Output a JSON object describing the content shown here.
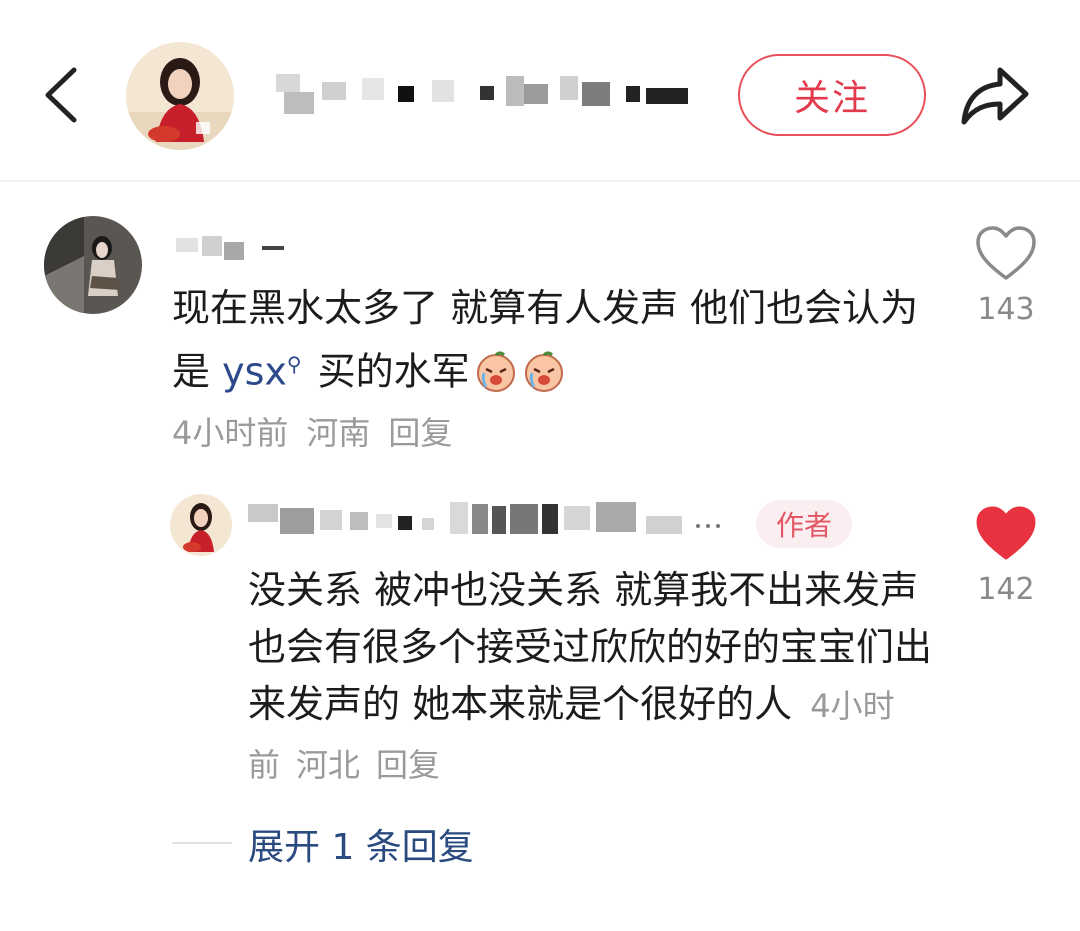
{
  "header": {
    "follow_label": "关注",
    "back_icon": "chevron-left-icon",
    "share_icon": "share-icon"
  },
  "comment": {
    "text_before_mention": "现在黑水太多了 就算有人发声 他们也会认为是",
    "mention": "ysx",
    "text_after_mention": "买的水军",
    "emoji": "crying-face-emoji",
    "time": "4小时前",
    "location": "河南",
    "reply_label": "回复",
    "like_count": "143",
    "liked": false
  },
  "reply": {
    "author_badge": "作者",
    "text": "没关系 被冲也没关系 就算我不出来发声也会有很多个接受过欣欣的好的宝宝们出来发声的 她本来就是个很好的人",
    "time": "4小时前",
    "location": "河北",
    "reply_label": "回复",
    "like_count": "142",
    "liked": true,
    "like_color": "#e8323f"
  },
  "expand_label": "展开 1 条回复",
  "colors": {
    "accent": "#e23a4a",
    "link": "#2a4a80",
    "meta": "#9a9a9a"
  }
}
